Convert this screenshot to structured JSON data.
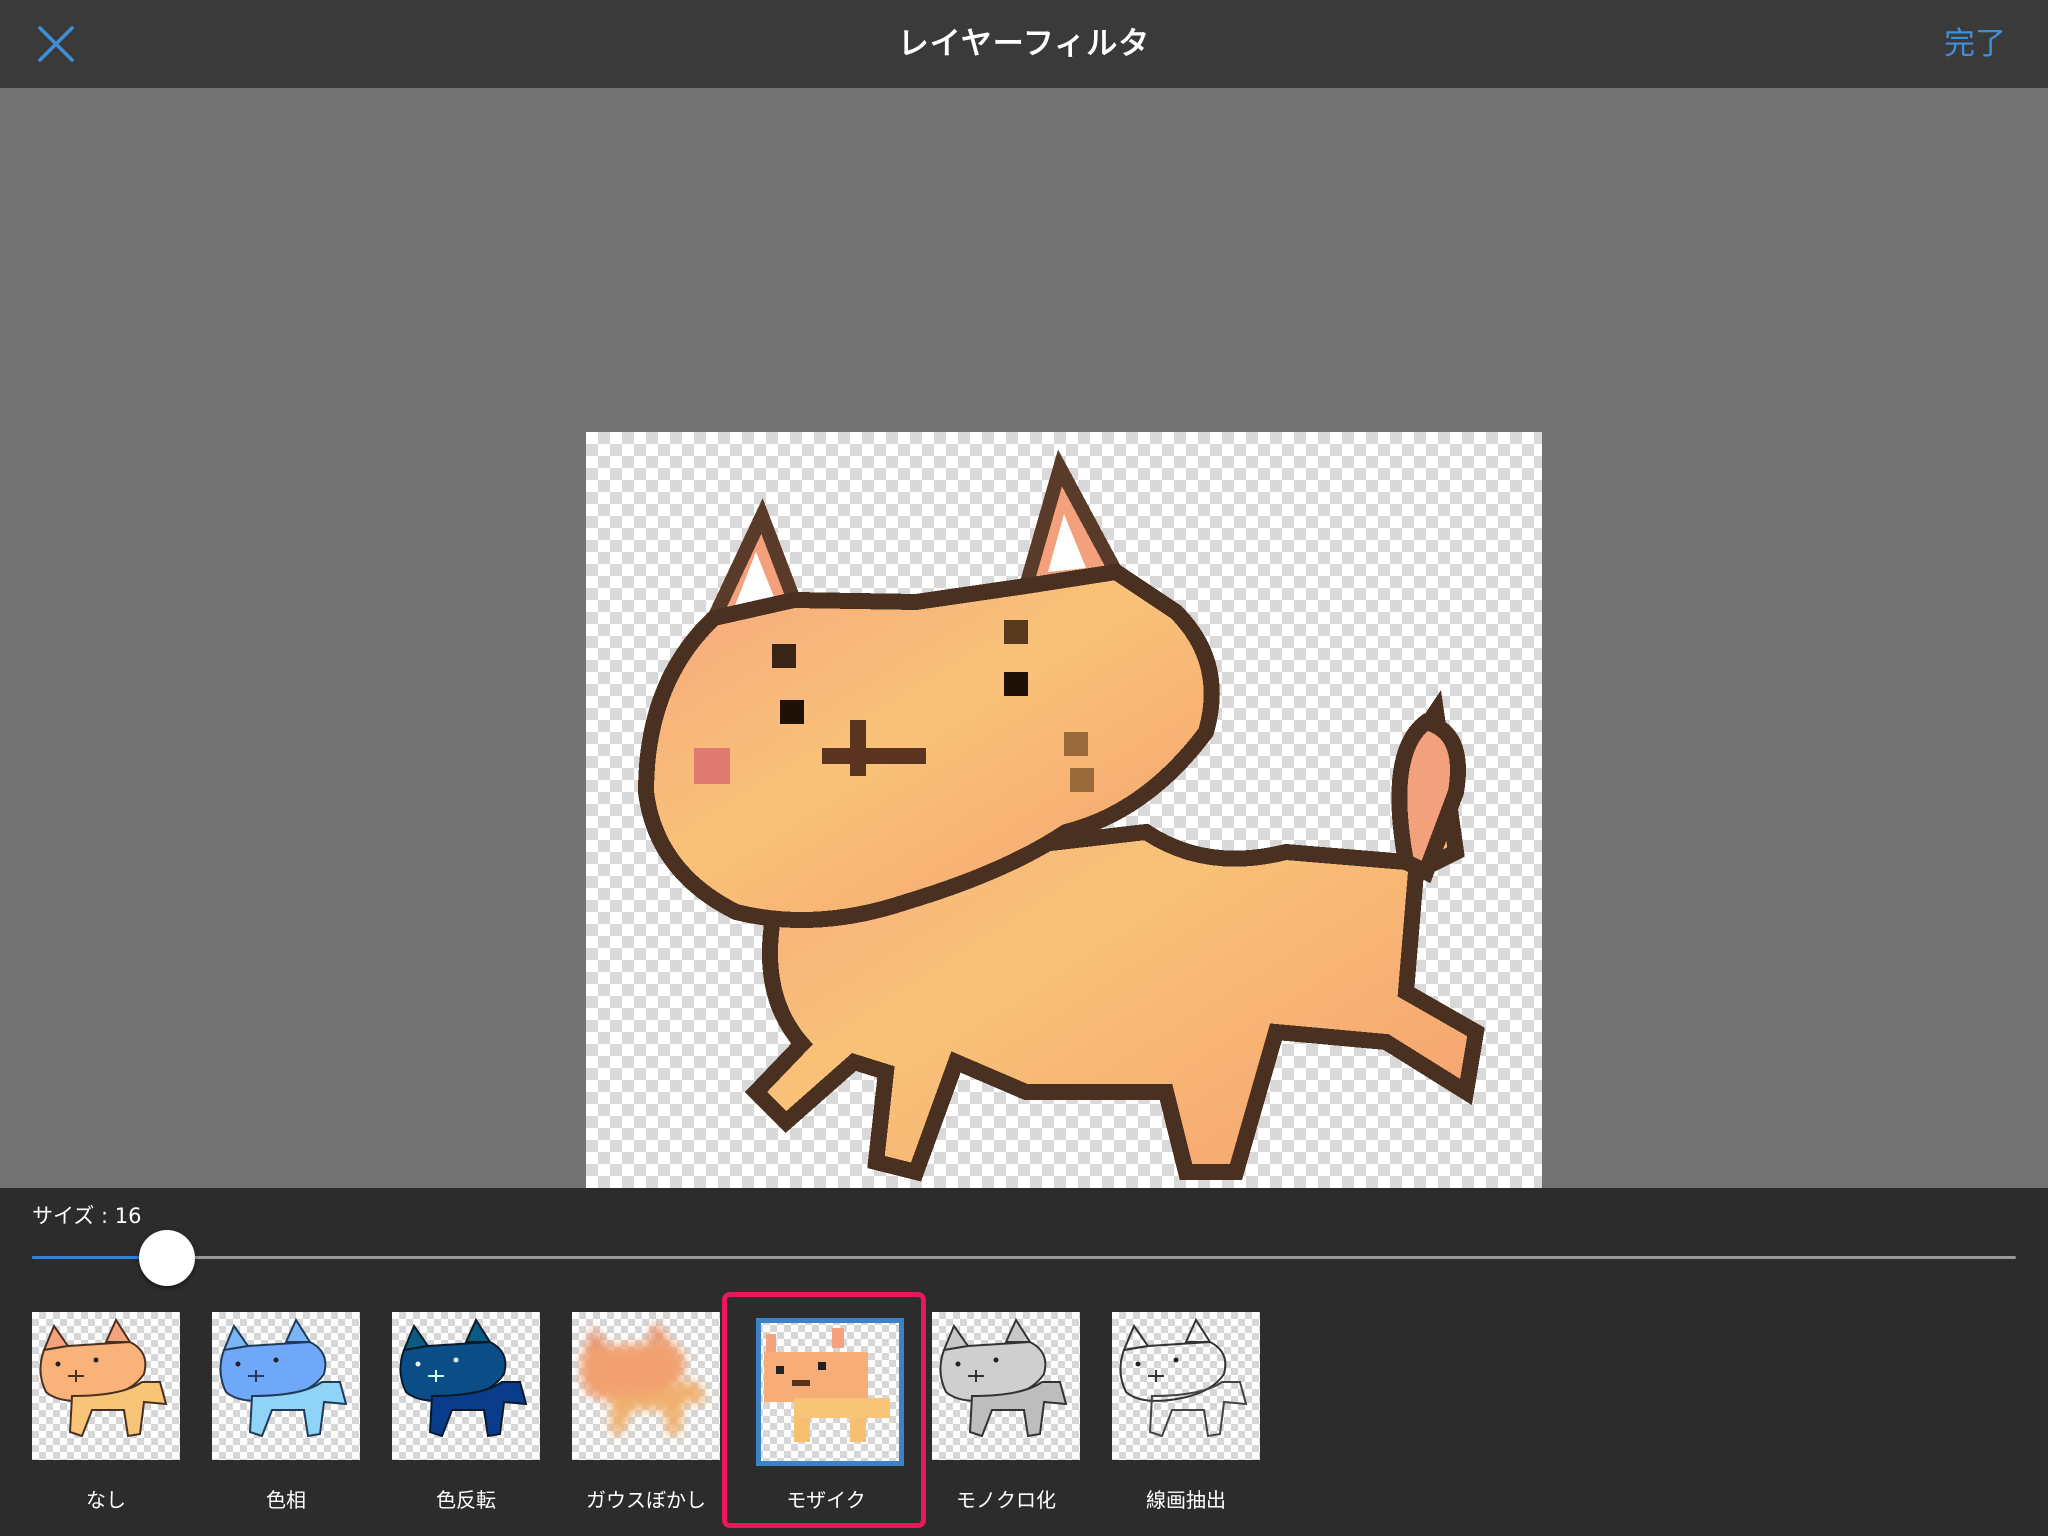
{
  "header": {
    "title": "レイヤーフィルタ",
    "close_icon": "close-x-icon",
    "done_label": "完了",
    "accent_color": "#3f8fd9"
  },
  "canvas": {
    "content": "mosaic-cat-image"
  },
  "slider": {
    "label": "サイズ : 16",
    "value": 16,
    "fraction": 0.068
  },
  "filters": {
    "items": [
      {
        "label": "なし",
        "selected": false
      },
      {
        "label": "色相",
        "selected": false
      },
      {
        "label": "色反転",
        "selected": false
      },
      {
        "label": "ガウスぼかし",
        "selected": false
      },
      {
        "label": "モザイク",
        "selected": true
      },
      {
        "label": "モノクロ化",
        "selected": false
      },
      {
        "label": "線画抽出",
        "selected": false
      }
    ],
    "highlight_color": "#e8185a",
    "selected_border_color": "#3b82c6"
  }
}
